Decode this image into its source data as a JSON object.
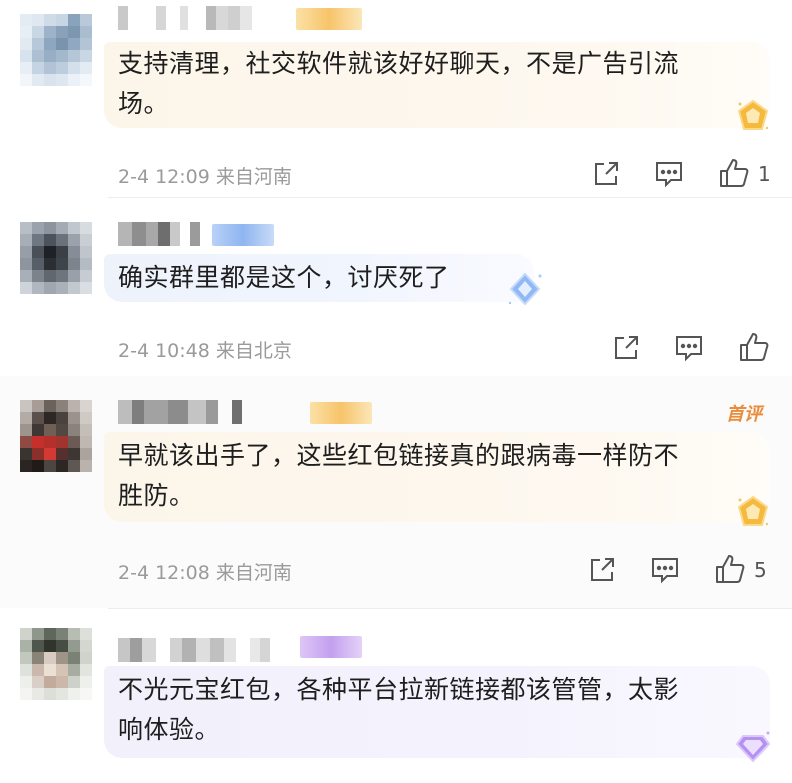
{
  "comments": [
    {
      "text": "支持清理，社交软件就该好好聊天，不是广告引流场。",
      "line1": "支持清理，社交软件就该好好聊天，不是广告引流",
      "line2": "场。",
      "time": "2-4 12:09",
      "location": "来自河南",
      "likes": "1",
      "bubble_style": "gold"
    },
    {
      "text": "确实群里都是这个，讨厌死了",
      "line1": "确实群里都是这个，讨厌死了",
      "time": "2-4 10:48",
      "location": "来自北京",
      "likes": "",
      "bubble_style": "blue"
    },
    {
      "text": "早就该出手了，这些红包链接真的跟病毒一样防不胜防。",
      "line1": "早就该出手了，这些红包链接真的跟病毒一样防不",
      "line2": "胜防。",
      "time": "2-4 12:08",
      "location": "来自河南",
      "likes": "5",
      "badge": "首评",
      "bubble_style": "gold"
    },
    {
      "text": "不光元宝红包，各种平台拉新链接都该管管，太影响体验。",
      "line1": "不光元宝红包，各种平台拉新链接都该管管，太影",
      "line2": "响体验。",
      "bubble_style": "purple"
    }
  ],
  "icons": {
    "share": "share-icon",
    "reply": "comment-icon",
    "like": "thumbs-up-icon"
  },
  "colors": {
    "meta_text": "#9a9a9a",
    "first_comment_badge": "#e98d3c",
    "gold_bubble": "#fbf5ea",
    "blue_bubble": "#eef2fb",
    "purple_bubble": "#f2f0fb"
  }
}
